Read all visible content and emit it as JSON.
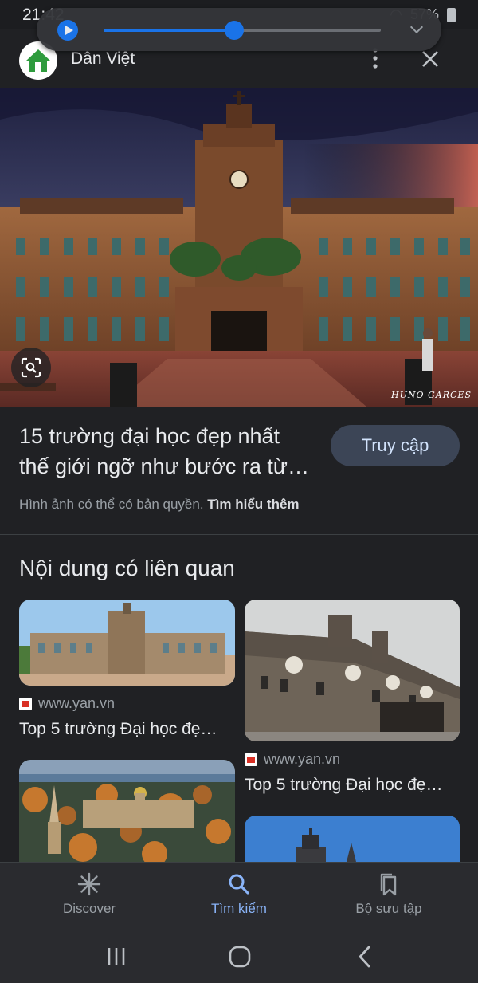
{
  "status_bar": {
    "time": "21:42",
    "battery": "57%"
  },
  "media": {
    "progress": 0.47
  },
  "header": {
    "site_name": "Dân Việt"
  },
  "hero": {
    "watermark": "HUNO GARCES"
  },
  "article": {
    "title": "15 trường đại học đẹp nhất thế giới ngỡ như bước ra từ…",
    "visit_label": "Truy cập",
    "copyright_text": "Hình ảnh có thể có bản quyền.",
    "learn_more": "Tìm hiểu thêm"
  },
  "related": {
    "heading": "Nội dung có liên quan",
    "cards": [
      {
        "source": "www.yan.vn",
        "title": "Top 5 trường Đại học đẹ…"
      },
      {
        "source": "www.yan.vn",
        "title": "Top 5 trường Đại học đẹ…"
      }
    ]
  },
  "bottom_nav": {
    "items": [
      {
        "label": "Discover",
        "icon": "asterisk-icon"
      },
      {
        "label": "Tìm kiếm",
        "icon": "search-icon",
        "active": true
      },
      {
        "label": "Bộ sưu tập",
        "icon": "bookmarks-icon"
      }
    ]
  },
  "colors": {
    "background": "#202124",
    "accent": "#8ab4f8",
    "button_bg": "#3c4556",
    "media_blue": "#1a73e8"
  }
}
